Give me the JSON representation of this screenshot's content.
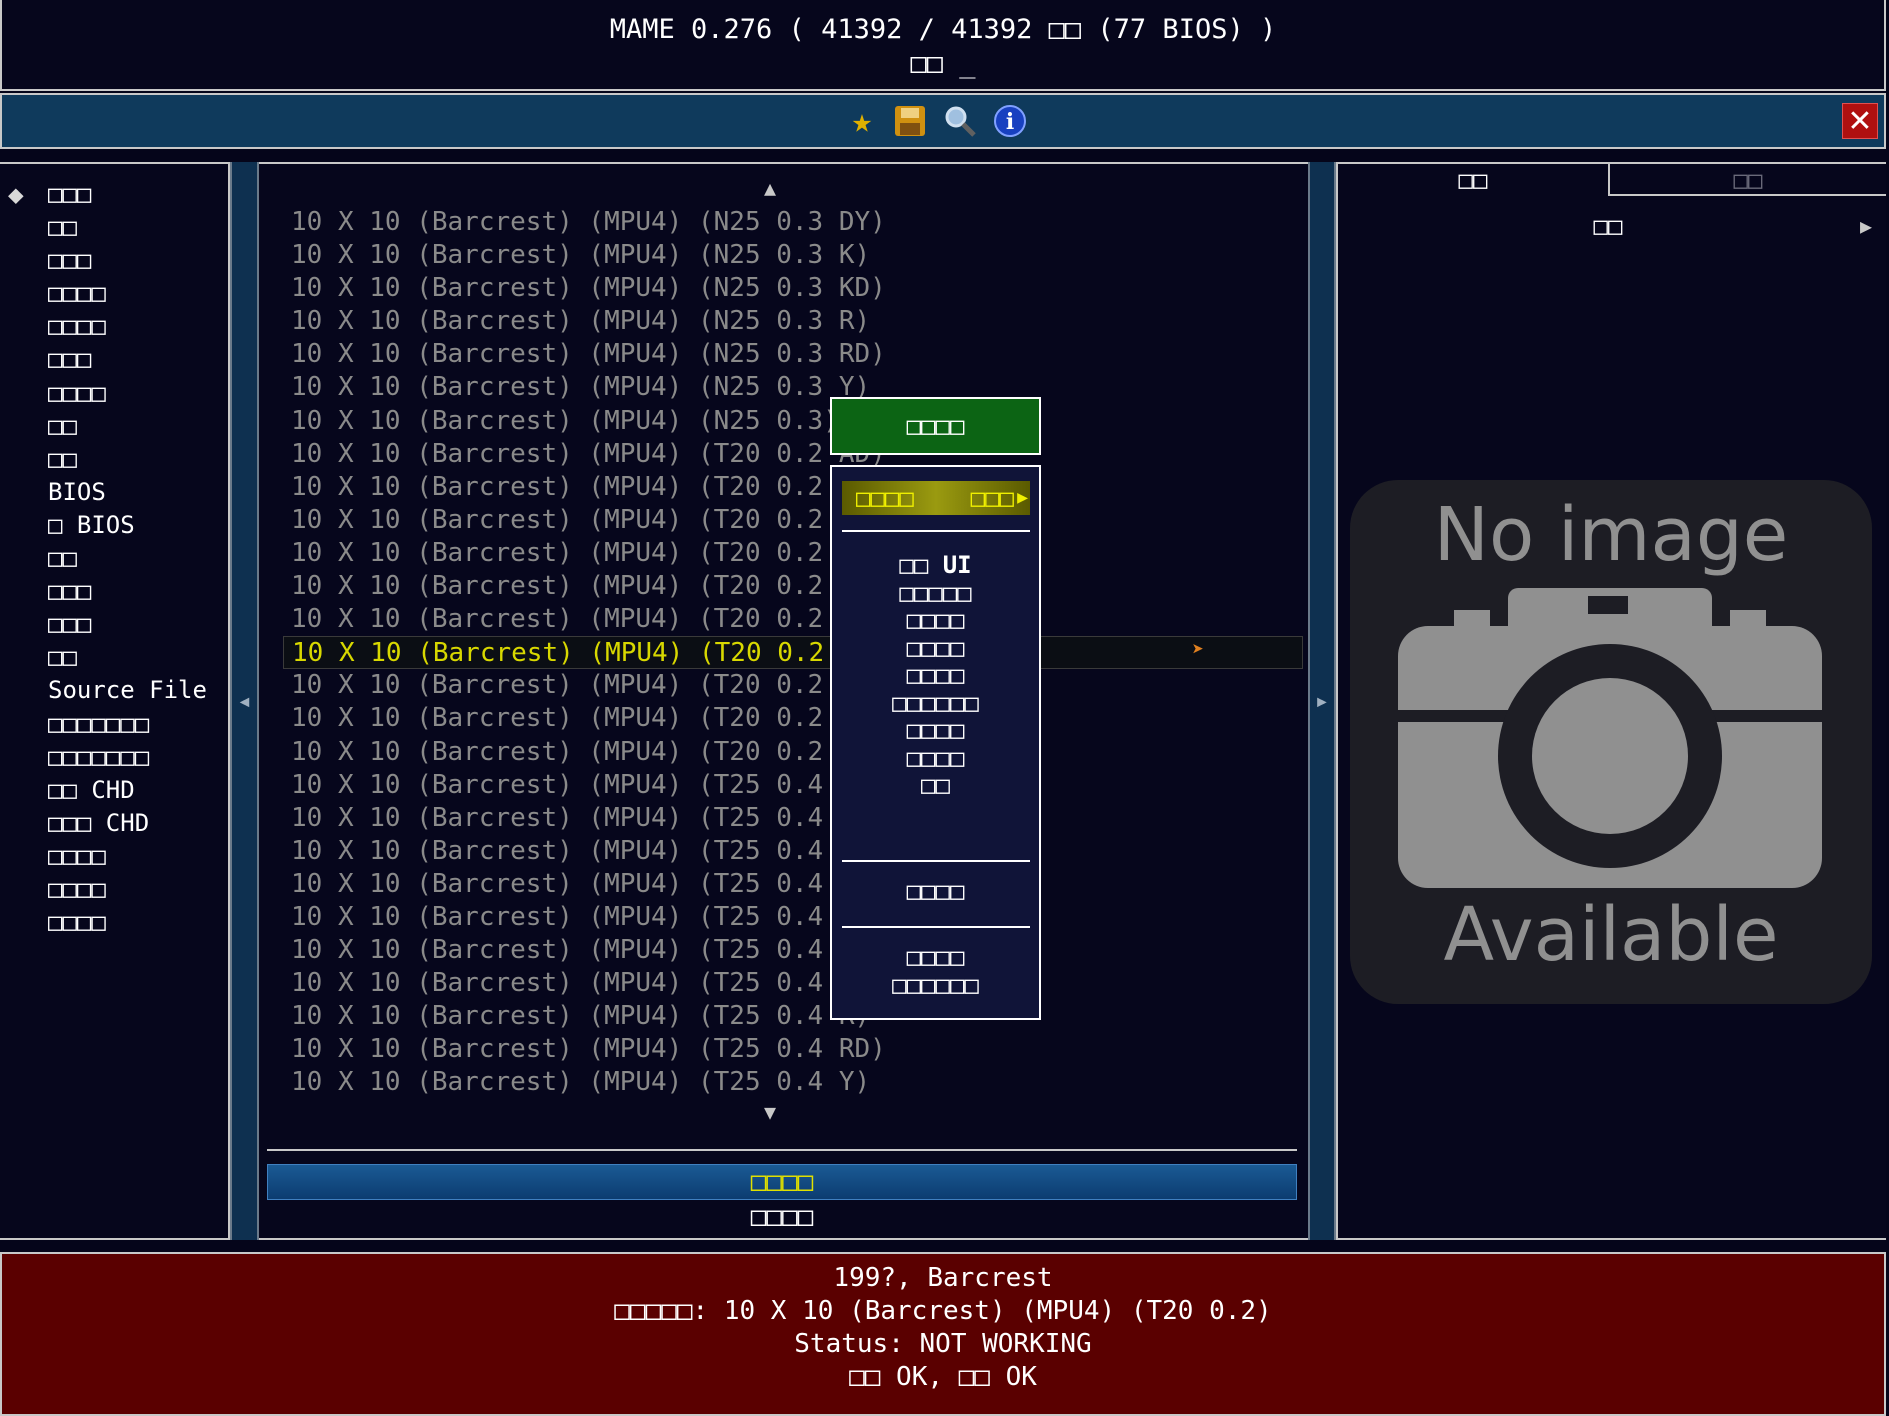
{
  "header": {
    "title_line1": "MAME 0.276 ( 41392 / 41392 □□ (77 BIOS) )",
    "title_line2": "□□ _"
  },
  "toolbar": {
    "icons": [
      "star-icon",
      "save-icon",
      "search-icon",
      "info-icon"
    ],
    "close_label": "✕"
  },
  "filters": {
    "items": [
      "□□□",
      "□□",
      "□□□",
      "□□□□",
      "□□□□",
      "□□□",
      "□□□□",
      "□□",
      "□□",
      "BIOS",
      "□ BIOS",
      "□□",
      "□□□",
      "□□□",
      "□□",
      "Source File",
      "□□□□□□□",
      "□□□□□□□",
      "□□ CHD",
      "□□□ CHD",
      "□□□□",
      "□□□□",
      "□□□□"
    ]
  },
  "gamelist": {
    "rows": [
      "10 X 10 (Barcrest) (MPU4) (N25 0.3 DY)",
      "10 X 10 (Barcrest) (MPU4) (N25 0.3 K)",
      "10 X 10 (Barcrest) (MPU4) (N25 0.3 KD)",
      "10 X 10 (Barcrest) (MPU4) (N25 0.3 R)",
      "10 X 10 (Barcrest) (MPU4) (N25 0.3 RD)",
      "10 X 10 (Barcrest) (MPU4) (N25 0.3 Y)",
      "10 X 10 (Barcrest) (MPU4) (N25 0.3)",
      "10 X 10 (Barcrest) (MPU4) (T20 0.2 AD)",
      "10 X 10 (Barcrest) (MPU4) (T20 0.2 B)",
      "10 X 10 (Barcrest) (MPU4) (T20 0.2 BD)",
      "10 X 10 (Barcrest) (MPU4) (T20 0.2 D)",
      "10 X 10 (Barcrest) (MPU4) (T20 0.2 DY)",
      "10 X 10 (Barcrest) (MPU4) (T20 0.2 K)",
      "10 X 10 (Barcrest) (MPU4) (T20 0.2 KD)",
      "10 X 10 (Barcrest) (MPU4) (T20 0.2 R)",
      "10 X 10 (Barcrest) (MPU4) (T20 0.2 RD)",
      "10 X 10 (Barcrest) (MPU4) (T20 0.2 Y)",
      "10 X 10 (Barcrest) (MPU4) (T25 0.4 AD)",
      "10 X 10 (Barcrest) (MPU4) (T25 0.4 B)",
      "10 X 10 (Barcrest) (MPU4) (T25 0.4 BD)",
      "10 X 10 (Barcrest) (MPU4) (T25 0.4 D)",
      "10 X 10 (Barcrest) (MPU4) (T25 0.4 DY)",
      "10 X 10 (Barcrest) (MPU4) (T25 0.4 K)",
      "10 X 10 (Barcrest) (MPU4) (T25 0.4 KD)",
      "10 X 10 (Barcrest) (MPU4) (T25 0.4 R)",
      "10 X 10 (Barcrest) (MPU4) (T25 0.4 RD)",
      "10 X 10 (Barcrest) (MPU4) (T25 0.4 Y)"
    ],
    "selected_row": "10 X 10 (Barcrest) (MPU4) (T20 0.2 KD)",
    "bottom_bar_1": "□□□□",
    "bottom_bar_2": "□□□□"
  },
  "right_panel": {
    "tab_1": "□□",
    "tab_2": "□□",
    "view_label": "□□",
    "no_image_line1": "No image",
    "no_image_line2": "Available"
  },
  "info": {
    "line1": "199?, Barcrest",
    "line2": "□□□□□: 10 X 10 (Barcrest) (MPU4) (T20 0.2)",
    "line3": "Status: NOT WORKING",
    "line4": "□□ OK, □□ OK"
  },
  "menu": {
    "title": "□□□□",
    "highlighted_left": "□□□□",
    "highlighted_right": "□□□",
    "group1": [
      "□□ UI",
      "□□□□□",
      "□□□□",
      "□□□□",
      "□□□□",
      "□□□□□□",
      "□□□□",
      "□□□□",
      "□□"
    ],
    "group2": [
      "□□□□"
    ],
    "group3": [
      "□□□□",
      "□□□□□□"
    ]
  },
  "colors": {
    "background": "#05051a",
    "toolbar": "#0f3a5c",
    "info_bar": "#5a0000",
    "menu_title": "#0c6414",
    "highlight_text": "#d8d800"
  }
}
